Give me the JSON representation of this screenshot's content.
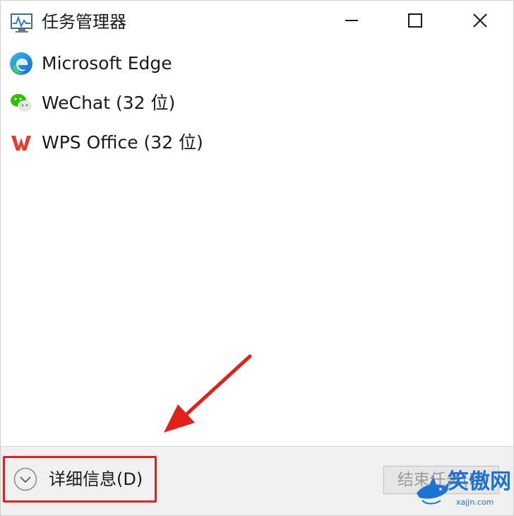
{
  "window": {
    "title": "任务管理器",
    "title_icon": "task-manager-icon",
    "controls": [
      "minimize-icon",
      "maximize-icon",
      "close-icon"
    ]
  },
  "apps": [
    {
      "name": "Microsoft Edge",
      "icon": "edge-icon"
    },
    {
      "name": "WeChat (32 位)",
      "icon": "wechat-icon"
    },
    {
      "name": "WPS Office (32 位)",
      "icon": "wps-icon"
    }
  ],
  "footer": {
    "details_label": "详细信息(D)",
    "details_icon": "chevron-down-icon",
    "end_task_label": "结束任务(E)",
    "end_task_enabled": false
  },
  "annotation": {
    "color": "#e0221b"
  },
  "watermark": {
    "text": "笑傲网",
    "sub": "xajjn.com"
  },
  "colors": {
    "footer_bg": "#f0f0f0",
    "highlight": "#e0221b",
    "watermark": "#1e73d2"
  }
}
